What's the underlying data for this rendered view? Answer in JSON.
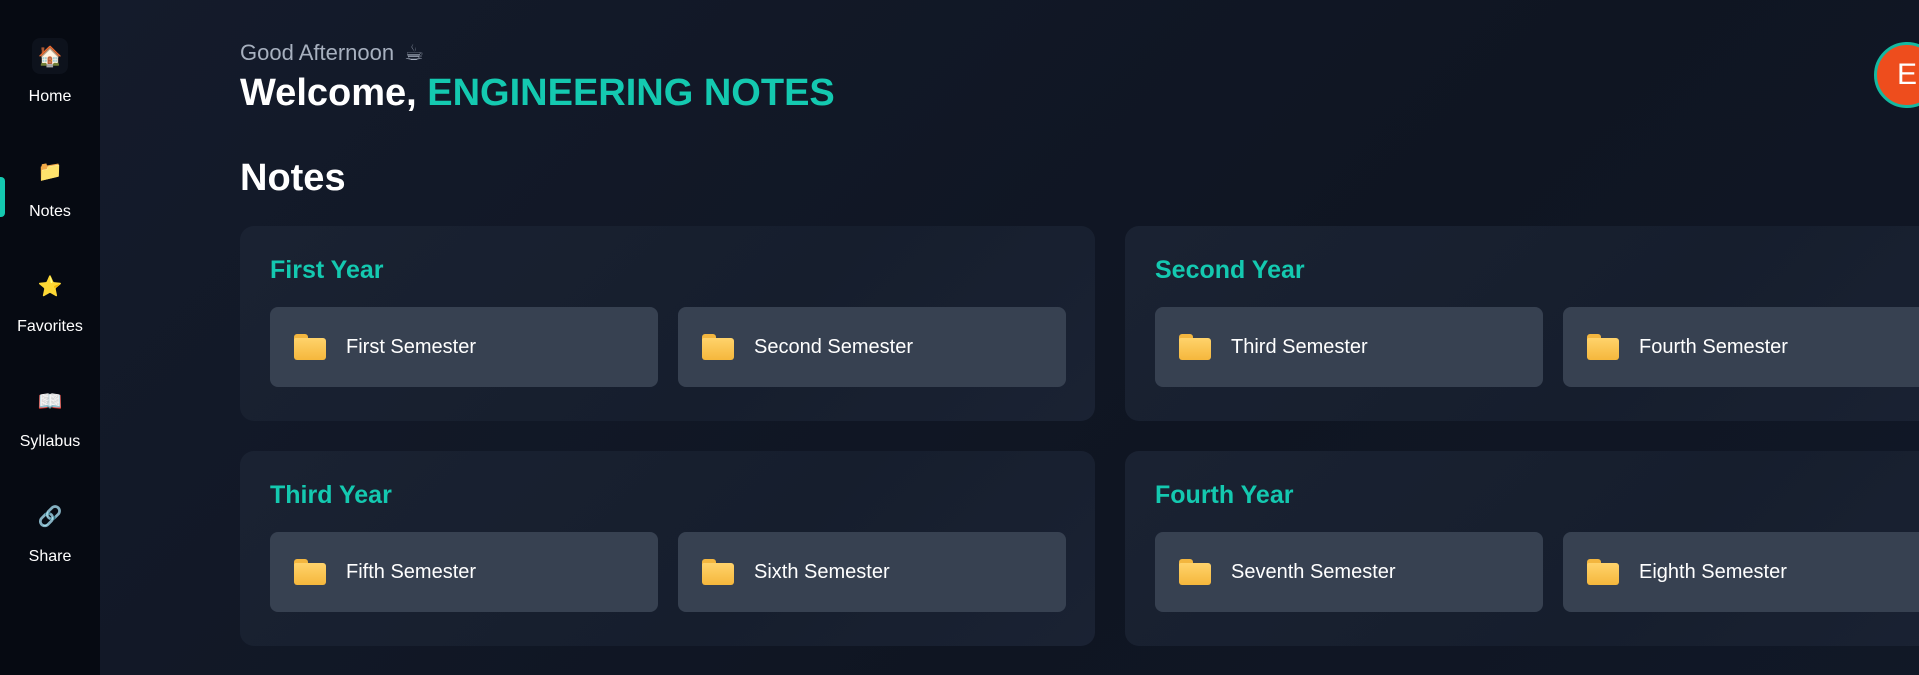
{
  "sidebar": {
    "items": [
      {
        "label": "Home",
        "icon": "🏠"
      },
      {
        "label": "Notes",
        "icon": "📁"
      },
      {
        "label": "Favorites",
        "icon": "⭐"
      },
      {
        "label": "Syllabus",
        "icon": "📖"
      },
      {
        "label": "Share",
        "icon": "🔗"
      }
    ],
    "active_index": 1
  },
  "header": {
    "greeting": "Good Afternoon",
    "greeting_icon": "☕",
    "welcome_prefix": "Welcome,",
    "user_name": "ENGINEERING NOTES",
    "avatar_initial": "E"
  },
  "section": {
    "title": "Notes"
  },
  "years": [
    {
      "title": "First Year",
      "semesters": [
        "First Semester",
        "Second Semester"
      ]
    },
    {
      "title": "Second Year",
      "semesters": [
        "Third Semester",
        "Fourth Semester"
      ]
    },
    {
      "title": "Third Year",
      "semesters": [
        "Fifth Semester",
        "Sixth Semester"
      ]
    },
    {
      "title": "Fourth Year",
      "semesters": [
        "Seventh Semester",
        "Eighth Semester"
      ]
    }
  ],
  "colors": {
    "accent": "#14c9b0",
    "avatar_bg": "#ee4d1d",
    "sidebar_bg": "#060a12",
    "card_bg": "#1a2232",
    "button_bg": "#374151"
  }
}
